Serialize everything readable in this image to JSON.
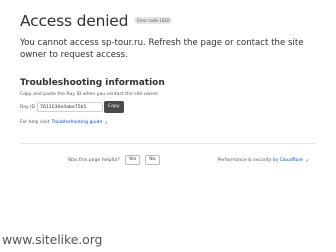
{
  "header": {
    "title": "Access denied",
    "error_badge": "Error code 1020"
  },
  "description": "You cannot access sp-tour.ru. Refresh the page or contact the site owner to request access.",
  "troubleshooting": {
    "title": "Troubleshooting information",
    "help_text": "Copy and paste the Ray ID when you contact the site owner.",
    "ray_label": "Ray ID",
    "ray_value": "7611030e4abe75b1",
    "copy_label": "Copy",
    "guide_prefix": "For help visit",
    "guide_link": "Troubleshooting guide"
  },
  "footer": {
    "helpful_question": "Was this page helpful?",
    "yes_label": "Yes",
    "no_label": "No",
    "perf_prefix": "Performance & security by",
    "perf_link": "Cloudflare"
  },
  "watermark": "www.sitelike.org",
  "icons": {
    "external_link": "external-link-icon"
  },
  "colors": {
    "link": "#0051c3",
    "copy_button": "#4a4a4a"
  }
}
